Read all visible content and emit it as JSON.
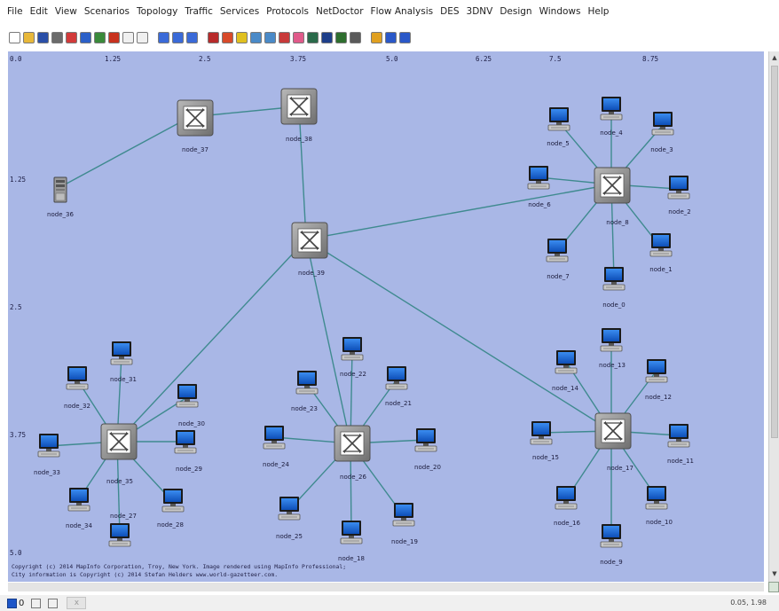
{
  "menu": [
    "File",
    "Edit",
    "View",
    "Scenarios",
    "Topology",
    "Traffic",
    "Services",
    "Protocols",
    "NetDoctor",
    "Flow Analysis",
    "DES",
    "3DNV",
    "Design",
    "Windows",
    "Help"
  ],
  "ruler": {
    "top": [
      "0.0",
      "1.25",
      "2.5",
      "3.75",
      "5.0",
      "6.25",
      "7.5",
      "8.75"
    ],
    "left": [
      "1.25",
      "2.5",
      "3.75",
      "5.0"
    ]
  },
  "copyright": {
    "line1": "Copyright (c) 2014 MapInfo Corporation, Troy, New York. Image rendered using MapInfo Professional;",
    "line2": "City information is Copyright (c) 2014 Stefan Helders www.world-gazetteer.com."
  },
  "nodes": {
    "node_0": "node_0",
    "node_1": "node_1",
    "node_2": "node_2",
    "node_3": "node_3",
    "node_4": "node_4",
    "node_5": "node_5",
    "node_6": "node_6",
    "node_7": "node_7",
    "node_8": "node_8",
    "node_9": "node_9",
    "node_10": "node_10",
    "node_11": "node_11",
    "node_12": "node_12",
    "node_13": "node_13",
    "node_14": "node_14",
    "node_15": "node_15",
    "node_16": "node_16",
    "node_17": "node_17",
    "node_18": "node_18",
    "node_19": "node_19",
    "node_20": "node_20",
    "node_21": "node_21",
    "node_22": "node_22",
    "node_23": "node_23",
    "node_24": "node_24",
    "node_25": "node_25",
    "node_26": "node_26",
    "node_27": "node_27",
    "node_28": "node_28",
    "node_29": "node_29",
    "node_30": "node_30",
    "node_31": "node_31",
    "node_32": "node_32",
    "node_33": "node_33",
    "node_34": "node_34",
    "node_35": "node_35",
    "node_36": "node_36",
    "node_37": "node_37",
    "node_38": "node_38",
    "node_39": "node_39"
  },
  "status": {
    "count": "0",
    "tab": "x",
    "coords": "0.05, 1.98"
  },
  "colors": {
    "canvas": "#a9b7e6",
    "link": "#3f8a8f",
    "switch": "#8f8f8f"
  }
}
